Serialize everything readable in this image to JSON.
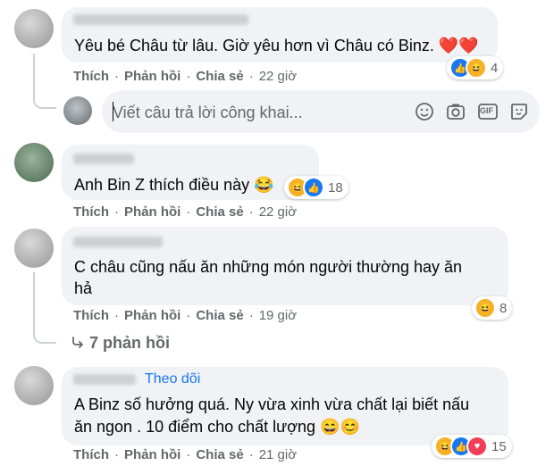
{
  "actions": {
    "like": "Thích",
    "reply": "Phản hồi",
    "share": "Chia sẻ"
  },
  "comments": [
    {
      "author": "Nguyen Thanh Hoa Lin",
      "text": "Yêu bé Châu từ lâu. Giờ yêu hơn vì Châu có Binz. ❤️❤️",
      "time": "22 giờ",
      "reactions": {
        "types": [
          "like",
          "haha"
        ],
        "count": "4"
      }
    },
    {
      "author": "Chanh Lin",
      "text": "Anh Bin Z thích điều này 😂",
      "time": "22 giờ",
      "reactions": {
        "types": [
          "haha",
          "like"
        ],
        "count": "18"
      }
    },
    {
      "author": "Ha Thi Huong",
      "text_line1": "C châu cũng nấu ăn những món người thường hay ăn",
      "text_line2": "hả",
      "time": "19 giờ",
      "reactions": {
        "types": [
          "haha"
        ],
        "count": "8"
      },
      "replies": "7 phản hồi"
    },
    {
      "author": "Thao Linh",
      "badge": "Theo dõi",
      "text_line1": "A Binz số hưởng quá. Ny vừa xinh vừa chất lại biết nấu",
      "text_line2": "ăn ngon . 10 điểm cho chất lượng 😄😊",
      "time": "21 giờ",
      "reactions": {
        "types": [
          "haha",
          "like",
          "love"
        ],
        "count": "15"
      }
    }
  ],
  "reply_box": {
    "placeholder": "Viết câu trả lời công khai...",
    "tools": [
      "emoji-icon",
      "camera-icon",
      "gif-icon",
      "sticker-icon"
    ],
    "gif_label": "GIF"
  }
}
